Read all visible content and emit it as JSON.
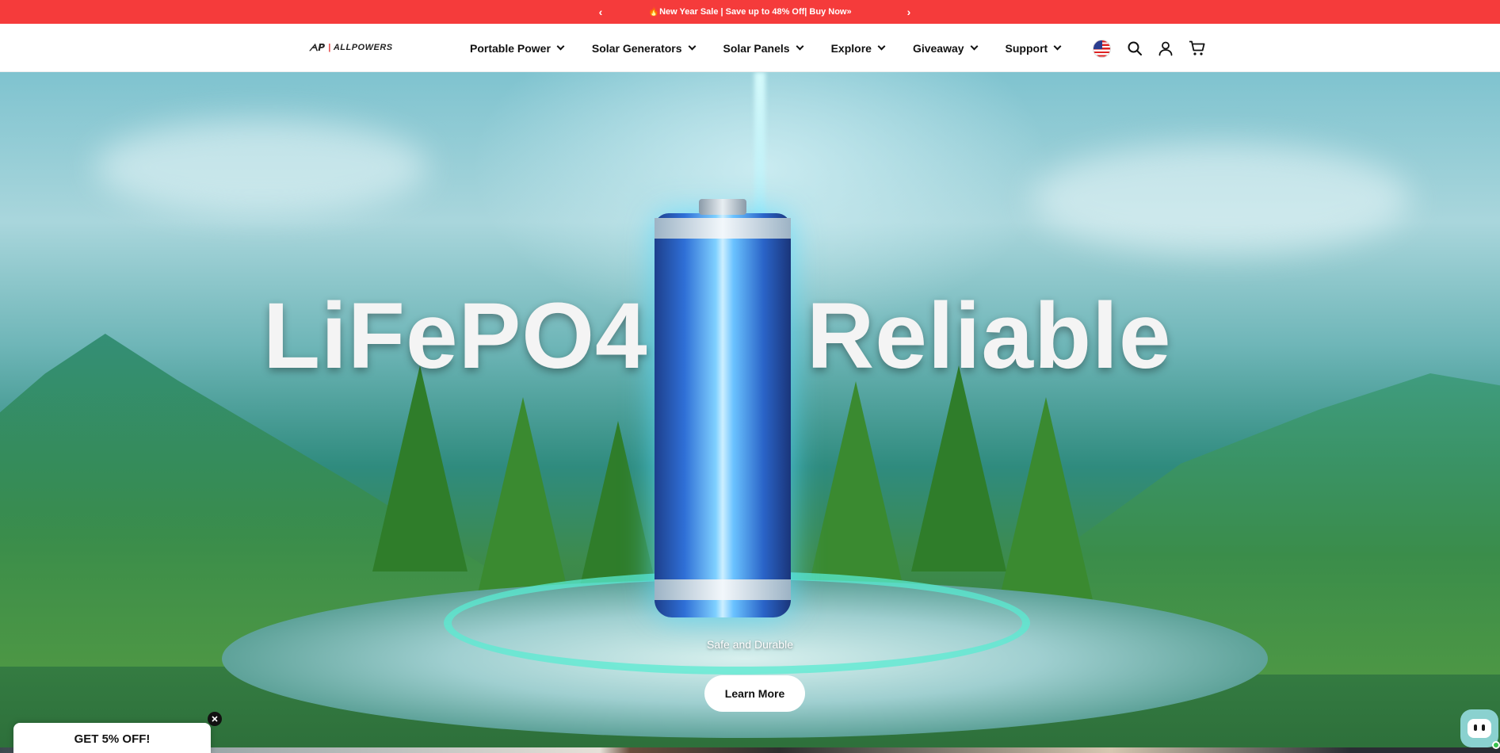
{
  "announcement": {
    "message": "🔥New Year Sale | Save up to 48% Off| Buy Now»",
    "prev_icon": "chevron-left-icon",
    "next_icon": "chevron-right-icon",
    "bg_color": "#f53b3b"
  },
  "header": {
    "logo": {
      "mark": "ᗅP",
      "word_prefix": "|",
      "word": "ALLPOWERS"
    },
    "nav": [
      {
        "label": "Portable Power"
      },
      {
        "label": "Solar Generators"
      },
      {
        "label": "Solar Panels"
      },
      {
        "label": "Explore"
      },
      {
        "label": "Giveaway"
      },
      {
        "label": "Support"
      }
    ],
    "icons": [
      "us-flag-icon",
      "search-icon",
      "account-icon",
      "cart-icon"
    ]
  },
  "hero": {
    "headline_left": "LiFePO4",
    "headline_right": "Reliable",
    "subtitle": "Safe and Durable",
    "cta_label": "Learn More"
  },
  "discount_popup": {
    "label": "GET 5% OFF!",
    "close_icon": "close-icon"
  },
  "chat": {
    "icon": "chat-bot-icon",
    "status_color": "#37c24c"
  }
}
